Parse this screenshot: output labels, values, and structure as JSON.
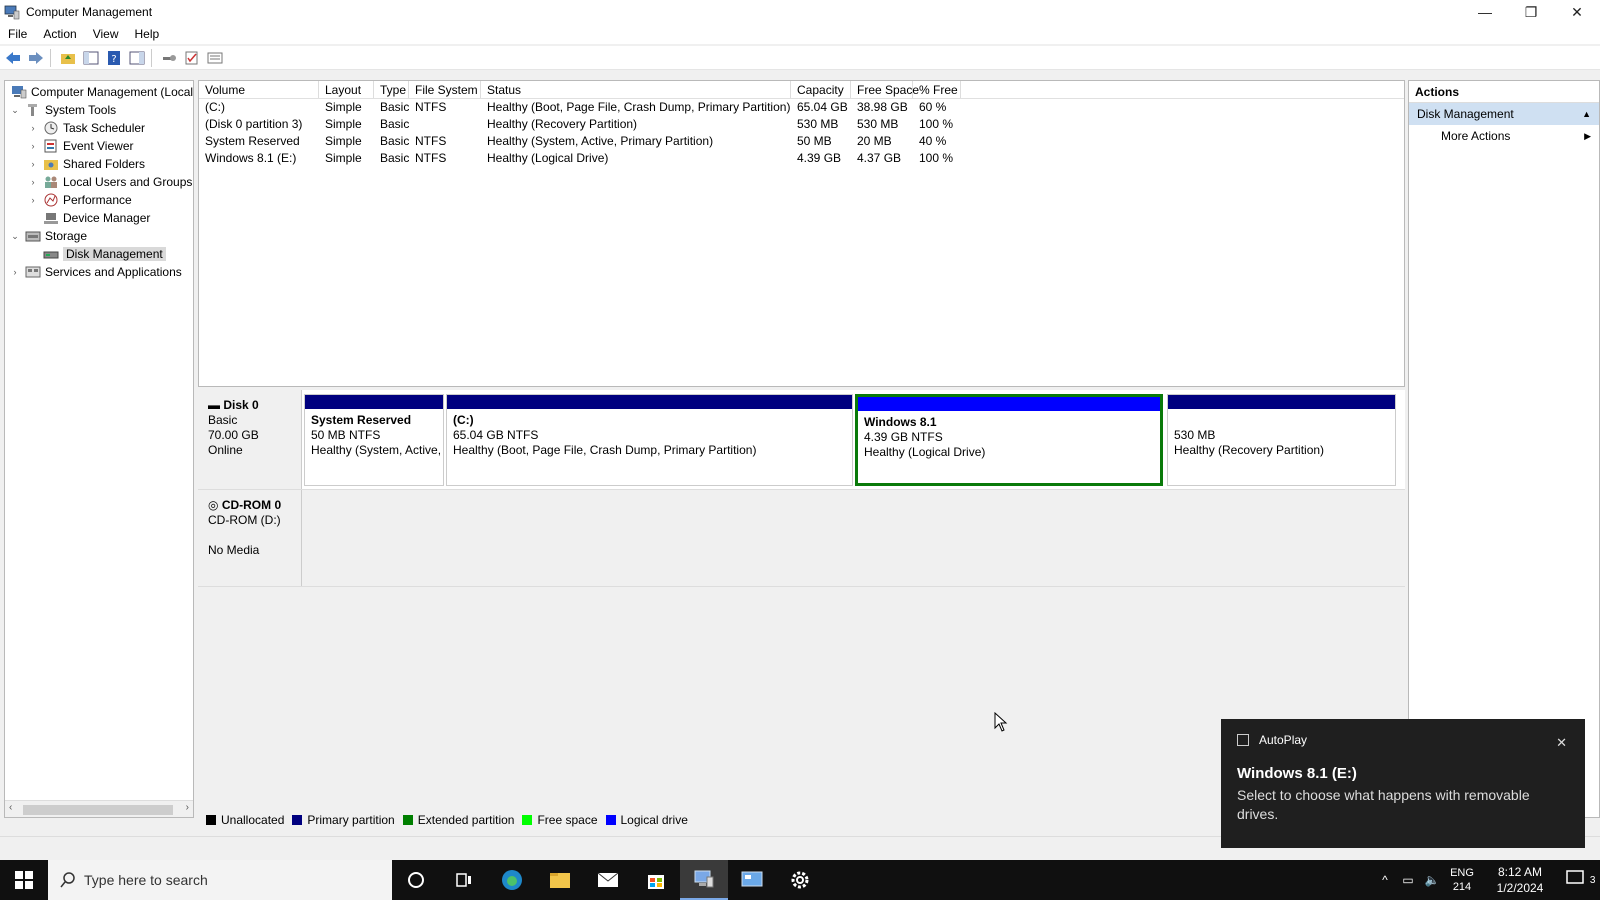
{
  "window": {
    "title": "Computer Management",
    "controls": {
      "minimize": "—",
      "restore": "❐",
      "close": "✕"
    }
  },
  "menu": [
    "File",
    "Action",
    "View",
    "Help"
  ],
  "tree": {
    "root": "Computer Management (Local",
    "items": [
      {
        "label": "System Tools",
        "expanded": true
      },
      {
        "label": "Task Scheduler"
      },
      {
        "label": "Event Viewer"
      },
      {
        "label": "Shared Folders"
      },
      {
        "label": "Local Users and Groups"
      },
      {
        "label": "Performance"
      },
      {
        "label": "Device Manager"
      },
      {
        "label": "Storage",
        "expanded": true
      },
      {
        "label": "Disk Management",
        "selected": true
      },
      {
        "label": "Services and Applications"
      }
    ]
  },
  "volumes": {
    "headers": [
      "Volume",
      "Layout",
      "Type",
      "File System",
      "Status",
      "Capacity",
      "Free Space",
      "% Free"
    ],
    "rows": [
      [
        "(C:)",
        "Simple",
        "Basic",
        "NTFS",
        "Healthy (Boot, Page File, Crash Dump, Primary Partition)",
        "65.04 GB",
        "38.98 GB",
        "60 %"
      ],
      [
        "(Disk 0 partition 3)",
        "Simple",
        "Basic",
        "",
        "Healthy (Recovery Partition)",
        "530 MB",
        "530 MB",
        "100 %"
      ],
      [
        "System Reserved",
        "Simple",
        "Basic",
        "NTFS",
        "Healthy (System, Active, Primary Partition)",
        "50 MB",
        "20 MB",
        "40 %"
      ],
      [
        "Windows 8.1 (E:)",
        "Simple",
        "Basic",
        "NTFS",
        "Healthy (Logical Drive)",
        "4.39 GB",
        "4.37 GB",
        "100 %"
      ]
    ]
  },
  "disk0": {
    "name": "Disk 0",
    "type": "Basic",
    "size": "70.00 GB",
    "status": "Online",
    "partitions": [
      {
        "name": "System Reserved",
        "size": "50 MB NTFS",
        "status": "Healthy (System, Active,"
      },
      {
        "name": "(C:)",
        "size": "65.04 GB NTFS",
        "status": "Healthy (Boot, Page File, Crash Dump, Primary Partition)"
      },
      {
        "name": "Windows 8.1",
        "size": "4.39 GB NTFS",
        "status": "Healthy (Logical Drive)"
      },
      {
        "name": "",
        "size": "530 MB",
        "status": "Healthy (Recovery Partition)"
      }
    ]
  },
  "cdrom0": {
    "name": "CD-ROM 0",
    "drive": "CD-ROM (D:)",
    "status": "No Media"
  },
  "legend": [
    {
      "label": "Unallocated",
      "color": "#000000"
    },
    {
      "label": "Primary partition",
      "color": "#00007f"
    },
    {
      "label": "Extended partition",
      "color": "#007f00"
    },
    {
      "label": "Free space",
      "color": "#00ff00"
    },
    {
      "label": "Logical drive",
      "color": "#0000ff"
    }
  ],
  "actions": {
    "header": "Actions",
    "section": "Disk Management",
    "items": [
      "More Actions"
    ]
  },
  "toast": {
    "app": "AutoPlay",
    "title": "Windows 8.1 (E:)",
    "body": "Select to choose what happens with removable drives."
  },
  "taskbar": {
    "search_placeholder": "Type here to search",
    "lang_top": "ENG",
    "lang_bottom": "214",
    "time": "8:12 AM",
    "date": "1/2/2024",
    "notification_count": "3"
  }
}
